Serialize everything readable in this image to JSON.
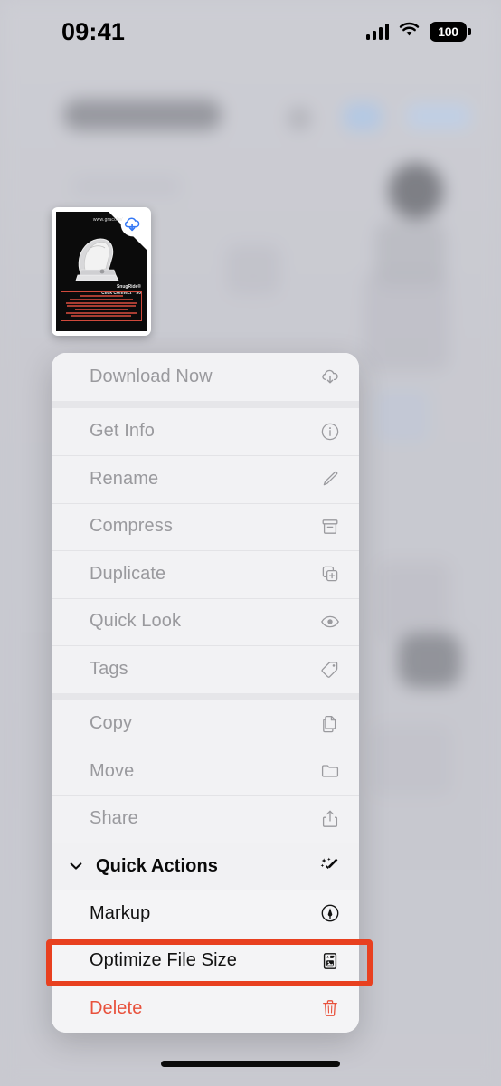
{
  "status_bar": {
    "time": "09:41",
    "cellular_icon": "signal-bars-icon",
    "wifi_icon": "wifi-icon",
    "battery_level": "100",
    "battery_icon": "battery-full-icon"
  },
  "preview": {
    "name": "file-thumbnail",
    "badge_icon": "icloud-download-icon",
    "badge_color": "#3478f6",
    "doc_brand": "www.gracobaby.com",
    "doc_model_line1": "SnugRide®",
    "doc_model_line2": "Click Connect™30",
    "doc_warning_title": "Read the manual",
    "doc_warning_sub": "KEEP INSTRUCTIONS FOR FUTURE USE"
  },
  "menu": {
    "groups": [
      {
        "name": "download-group",
        "items": [
          {
            "label": "Download Now",
            "icon": "icloud-download-icon",
            "dimmed": true
          }
        ]
      },
      {
        "name": "file-group",
        "items": [
          {
            "label": "Get Info",
            "icon": "info-circle-icon",
            "dimmed": true
          },
          {
            "label": "Rename",
            "icon": "pencil-icon",
            "dimmed": true
          },
          {
            "label": "Compress",
            "icon": "archive-box-icon",
            "dimmed": true
          },
          {
            "label": "Duplicate",
            "icon": "duplicate-icon",
            "dimmed": true
          },
          {
            "label": "Quick Look",
            "icon": "eye-icon",
            "dimmed": true
          },
          {
            "label": "Tags",
            "icon": "tag-icon",
            "dimmed": true
          }
        ]
      },
      {
        "name": "transfer-group",
        "items": [
          {
            "label": "Copy",
            "icon": "copy-documents-icon",
            "dimmed": true
          },
          {
            "label": "Move",
            "icon": "folder-icon",
            "dimmed": true
          },
          {
            "label": "Share",
            "icon": "share-up-arrow-icon",
            "dimmed": true
          }
        ]
      }
    ],
    "quick_actions": {
      "title": "Quick Actions",
      "chevron_icon": "chevron-down-icon",
      "wand_icon": "magic-wand-sparkles-icon",
      "items": [
        {
          "label": "Markup",
          "icon": "markup-pen-circle-icon",
          "destructive": false
        },
        {
          "label": "Optimize File Size",
          "icon": "optimize-document-icon",
          "destructive": false
        },
        {
          "label": "Delete",
          "icon": "trash-icon",
          "destructive": true
        }
      ]
    }
  },
  "highlight": {
    "name": "optimize-file-size-highlight",
    "target_label": "Optimize File Size",
    "color": "#e8401f"
  },
  "home_indicator": {
    "name": "home-indicator"
  }
}
